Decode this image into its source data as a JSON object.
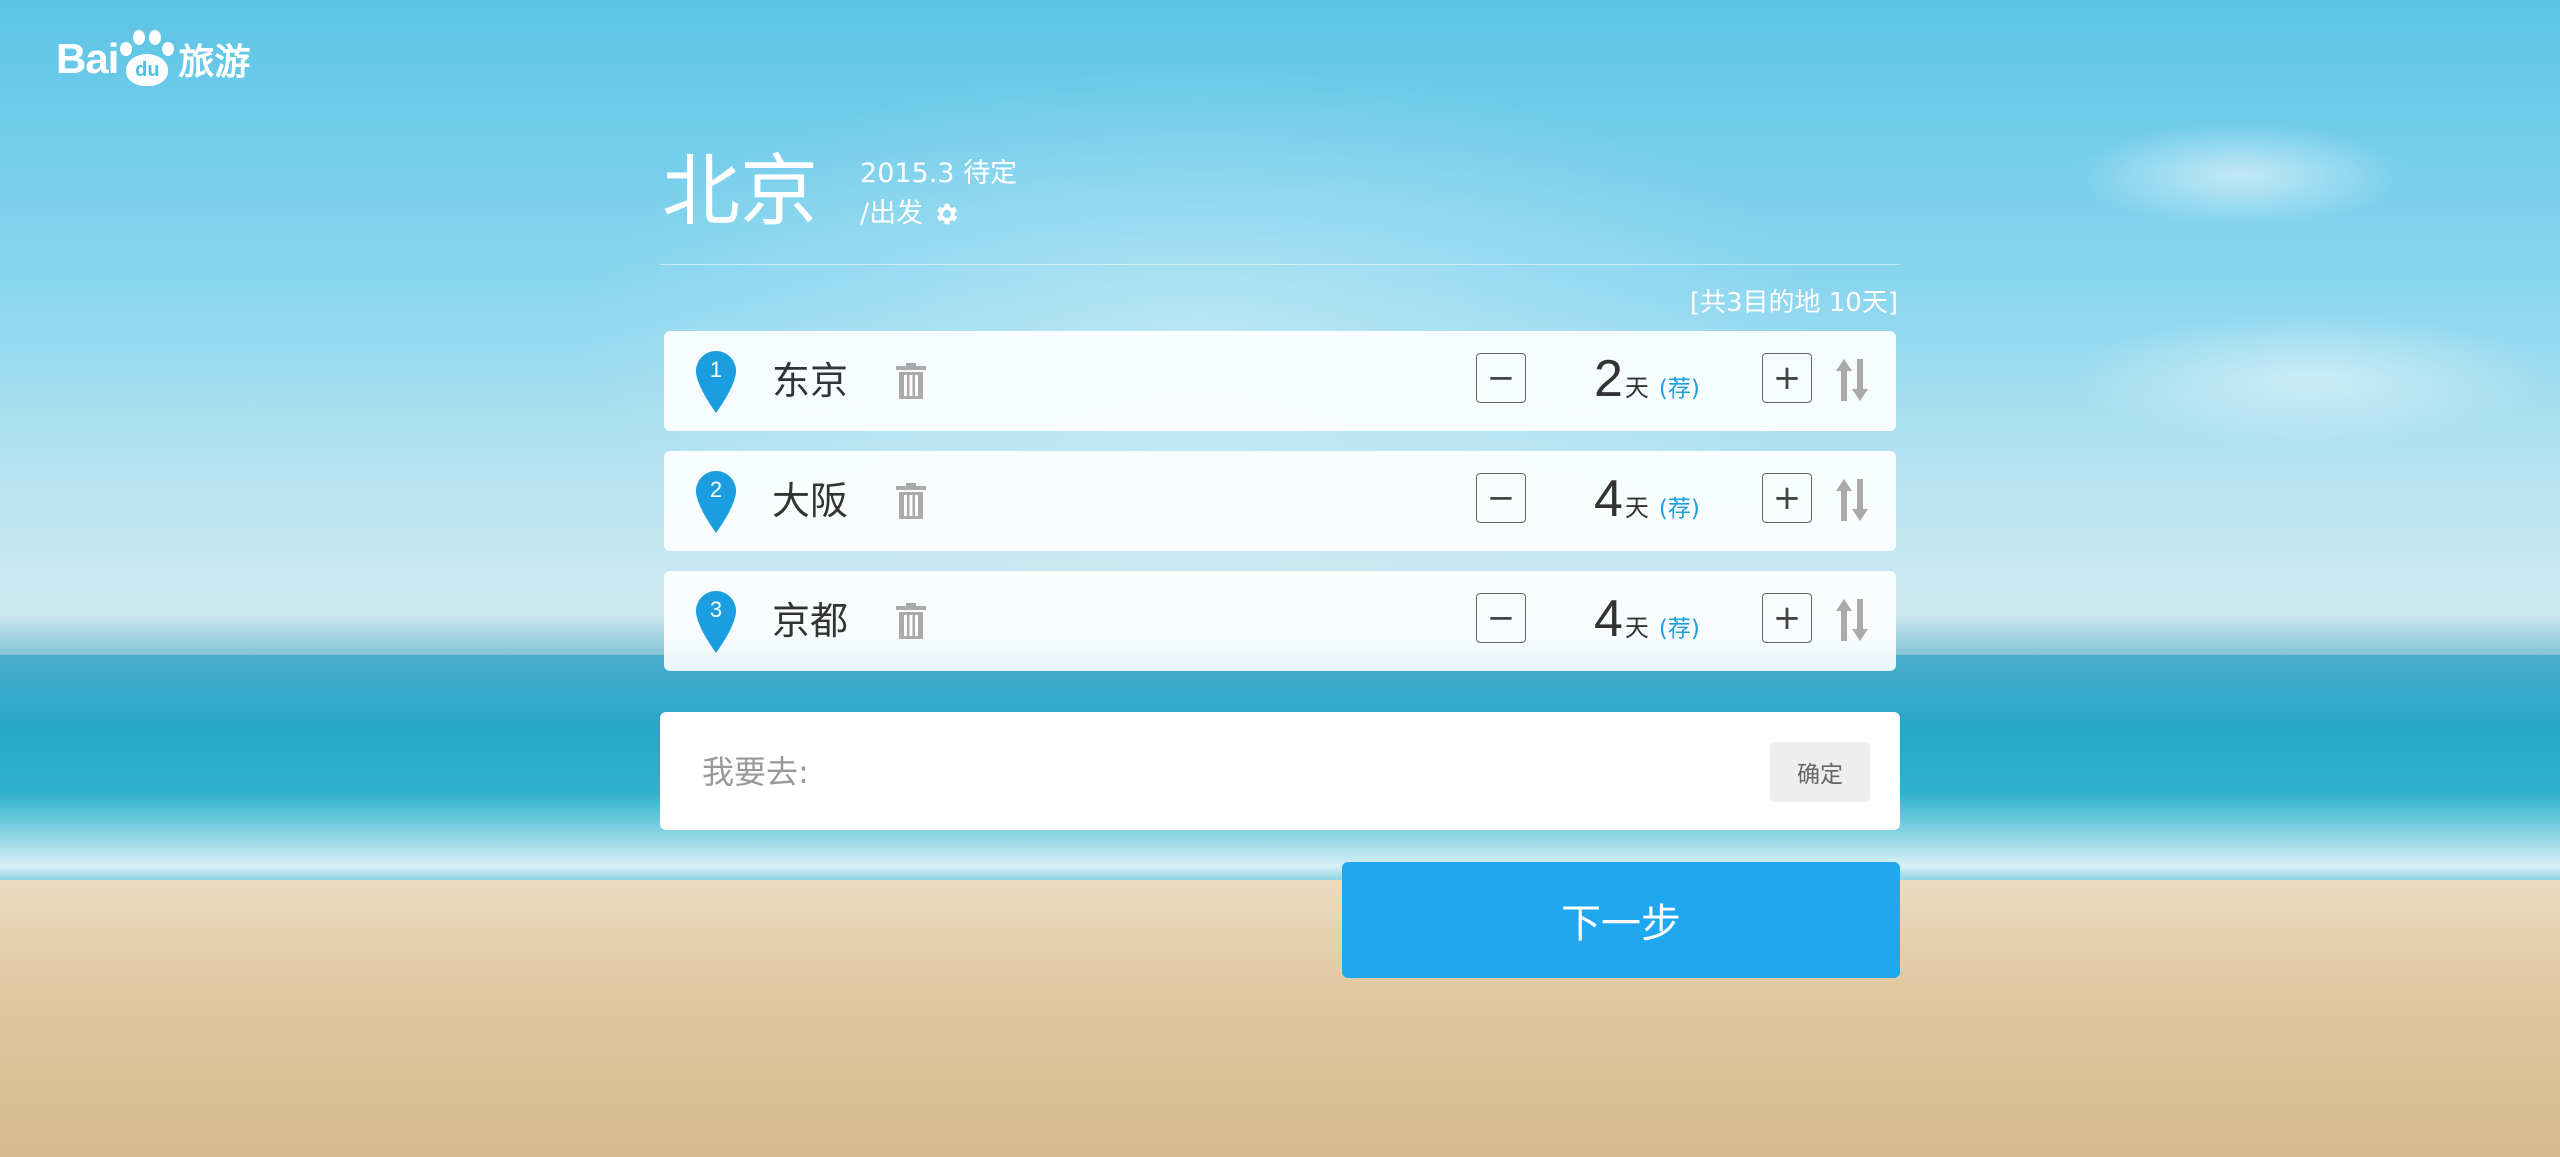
{
  "logo": {
    "latin": "Bai",
    "paw_text": "du",
    "chinese": "旅游"
  },
  "header": {
    "city": "北京",
    "date": "2015.3 待定",
    "depart": "/出发"
  },
  "summary": "[共3目的地 10天]",
  "destinations": [
    {
      "index": "1",
      "name": "东京",
      "days": "2",
      "unit": "天",
      "recommend": "(荐)",
      "minus": "−",
      "plus": "+"
    },
    {
      "index": "2",
      "name": "大阪",
      "days": "4",
      "unit": "天",
      "recommend": "(荐)",
      "minus": "−",
      "plus": "+"
    },
    {
      "index": "3",
      "name": "京都",
      "days": "4",
      "unit": "天",
      "recommend": "(荐)",
      "minus": "−",
      "plus": "+"
    }
  ],
  "search": {
    "placeholder": "我要去:",
    "confirm_label": "确定"
  },
  "next_label": "下一步",
  "colors": {
    "accent": "#1fa7ef",
    "pin": "#1a9ee0",
    "recommend": "#1a9ee0",
    "icon_gray": "#aaaaaa"
  },
  "icons": {
    "settings": "gear-icon",
    "delete": "trash-icon",
    "reorder": "sort-icon",
    "marker": "map-pin-icon"
  }
}
